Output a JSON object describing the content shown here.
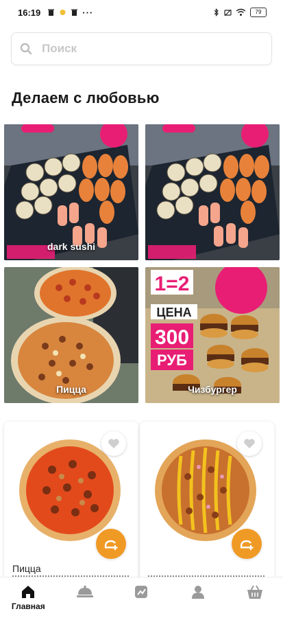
{
  "status_bar": {
    "time": "16:19",
    "battery": "79"
  },
  "search": {
    "placeholder": "Поиск"
  },
  "section": {
    "title": "Делаем с любовью"
  },
  "categories": [
    {
      "label": "dark sushi"
    },
    {
      "label": ""
    },
    {
      "label": "Пицца"
    },
    {
      "label": "Чизбургер"
    }
  ],
  "tile_text": {
    "badge": "ЦЕНА",
    "price": "300",
    "currency": "РУБ",
    "logo": "1=2"
  },
  "products": [
    {
      "name": "Пицца"
    },
    {
      "name": ""
    }
  ],
  "nav": [
    {
      "label": "Главная",
      "icon": "home-icon"
    },
    {
      "label": "",
      "icon": "delivery-icon"
    },
    {
      "label": "",
      "icon": "chart-icon"
    },
    {
      "label": "",
      "icon": "user-icon"
    },
    {
      "label": "",
      "icon": "basket-icon"
    }
  ],
  "colors": {
    "accent": "#f09a26",
    "text": "#1a1a1a"
  }
}
